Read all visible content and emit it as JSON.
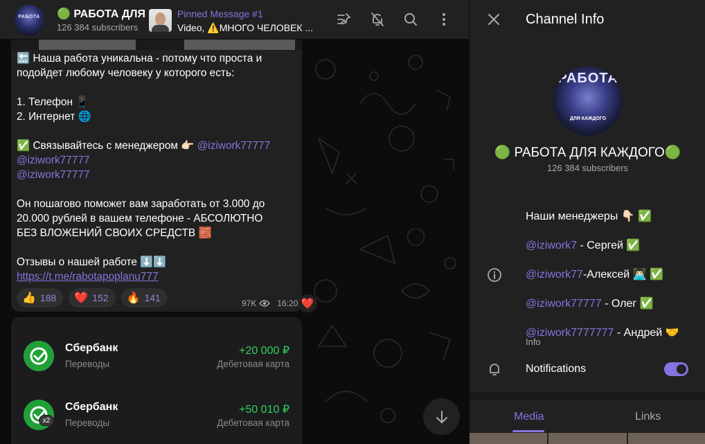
{
  "header": {
    "channel_title": "🟢 РАБОТА ДЛЯ КАЖДОГО🟢",
    "subscribers": "126 384 subscribers",
    "avatar_text": "РАБОТА",
    "pinned_title": "Pinned Message #1",
    "pinned_text": "Video, ⚠️МНОГО ЧЕЛОВЕК ..."
  },
  "message": {
    "lines": [
      "🔚 Наша работа уникальна - потому что проста и",
      "подойдет любому человеку у которого есть:",
      "",
      "1. Телефон 📱",
      "2. Интернет 🌐",
      "",
      "✅ Связывайтесь с менеджером 👉🏻 ",
      "",
      "",
      "",
      "Он пошагово поможет вам заработать от 3.000 до",
      "20.000 рублей в вашем телефоне - АБСОЛЮТНО",
      "БЕЗ ВЛОЖЕНИЙ СВОИХ СРЕДСТВ 🧱",
      "",
      "Отзывы о нашей работе ⬇️⬇️"
    ],
    "mention1": "@iziwork77777",
    "mention2": "@iziwork77777",
    "mention3": "@iziwork77777",
    "url": "https://t.me/rabotapoplanu777",
    "reactions": [
      {
        "emoji": "👍",
        "count": "188"
      },
      {
        "emoji": "❤️",
        "count": "152"
      },
      {
        "emoji": "🔥",
        "count": "141"
      }
    ],
    "views": "97K",
    "time": "16:20",
    "quick_reaction": "❤️"
  },
  "bank": [
    {
      "name": "Сбербанк",
      "sub": "Переводы",
      "amount": "+20 000 ₽",
      "type": "Дебетовая карта",
      "badge": ""
    },
    {
      "name": "Сбербанк",
      "sub": "Переводы",
      "amount": "+50 010 ₽",
      "type": "Дебетовая карта",
      "badge": "x2"
    }
  ],
  "panel": {
    "title": "Channel Info",
    "avatar_title": "РАБОТА",
    "avatar_sub": "ДЛЯ КАЖДОГО",
    "name": "🟢 РАБОТА ДЛЯ КАЖДОГО🟢",
    "subscribers": "126 384 subscribers",
    "info_rows": [
      {
        "link": "",
        "text": "Наши менеджеры 👇🏻 ✅"
      },
      {
        "link": "@iziwork7",
        "text": " - Сергей ✅"
      },
      {
        "link": "@iziwork77",
        "text": "-Алексей 👨🏻‍💻 ✅"
      },
      {
        "link": "@iziwork77777",
        "text": " - Олег ✅"
      },
      {
        "link": "@iziwork7777777",
        "text": " - Андрей 🤝"
      }
    ],
    "info_label": "Info",
    "notifications_label": "Notifications",
    "notifications_on": true,
    "tabs": [
      "Media",
      "Links"
    ]
  },
  "colors": {
    "accent": "#8774e1",
    "panel_bg": "#212121",
    "sber_green": "#21a038",
    "amount_green": "#30d158"
  }
}
